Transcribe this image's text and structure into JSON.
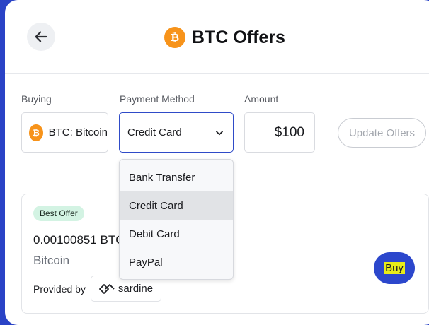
{
  "header": {
    "title": "BTC Offers",
    "back_icon": "arrow-left-icon",
    "logo_icon": "bitcoin-icon"
  },
  "form": {
    "buying": {
      "label": "Buying",
      "value": "BTC: Bitcoin"
    },
    "payment": {
      "label": "Payment Method",
      "value": "Credit Card"
    },
    "amount": {
      "label": "Amount",
      "value": "$100"
    },
    "update_button": "Update Offers"
  },
  "dropdown": {
    "options": [
      "Bank Transfer",
      "Credit Card",
      "Debit Card",
      "PayPal"
    ],
    "selected": "Credit Card"
  },
  "offer": {
    "badge": "Best Offer",
    "amount": "0.00100851 BTC",
    "asset": "Bitcoin",
    "provided_by": "Provided by",
    "provider": "sardine",
    "buy_button": "Buy"
  },
  "colors": {
    "accent": "#2c47cc",
    "bitcoin": "#f7931a",
    "badge_bg": "#d3f3e3",
    "highlight": "#e8ec18"
  }
}
